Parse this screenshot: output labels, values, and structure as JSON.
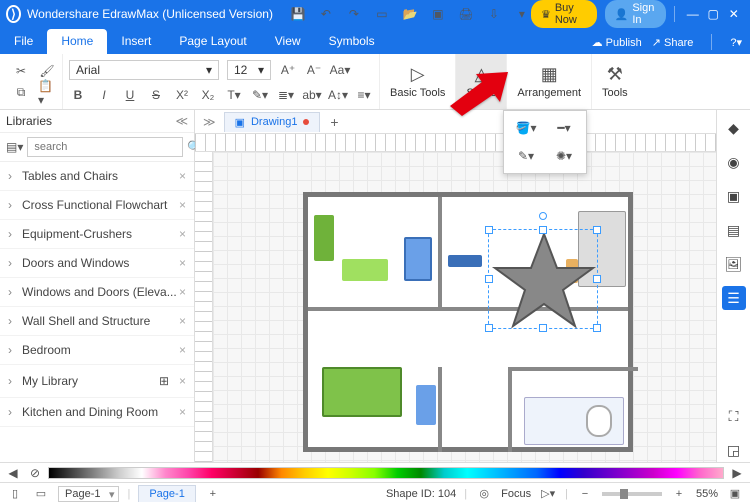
{
  "titlebar": {
    "app_title": "Wondershare EdrawMax (Unlicensed Version)",
    "buy_label": "Buy Now",
    "signin_label": "Sign In"
  },
  "menubar": {
    "items": [
      "File",
      "Home",
      "Insert",
      "Page Layout",
      "View",
      "Symbols"
    ],
    "active": "Home",
    "publish": "Publish",
    "share": "Share"
  },
  "ribbon": {
    "font_name": "Arial",
    "font_size": "12",
    "groups": {
      "basic": "Basic Tools",
      "styles": "Styles",
      "arrangement": "Arrangement",
      "tools": "Tools"
    }
  },
  "sidebar": {
    "title": "Libraries",
    "search_placeholder": "search",
    "items": [
      {
        "label": "Tables and Chairs"
      },
      {
        "label": "Cross Functional Flowchart"
      },
      {
        "label": "Equipment-Crushers"
      },
      {
        "label": "Doors and Windows"
      },
      {
        "label": "Windows and Doors (Eleva..."
      },
      {
        "label": "Wall Shell and Structure"
      },
      {
        "label": "Bedroom"
      },
      {
        "label": "My Library"
      },
      {
        "label": "Kitchen and Dining Room"
      }
    ]
  },
  "doctab": {
    "name": "Drawing1"
  },
  "statusbar": {
    "page_selector": "Page-1",
    "page_tab": "Page-1",
    "shape_id": "Shape ID: 104",
    "focus": "Focus",
    "zoom": "55%"
  }
}
